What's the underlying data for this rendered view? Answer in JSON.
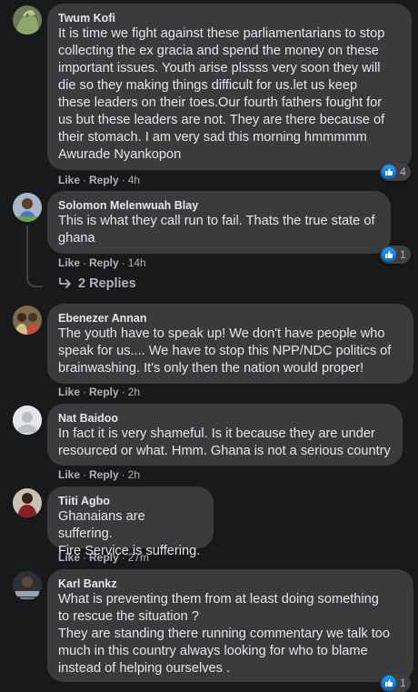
{
  "comments": [
    {
      "author": "Twum Kofi",
      "text": "It is time we fight against these parliamentarians to stop\ncollecting the ex gracia and spend the money on these\nimportant issues. Youth arise plssss very soon they will\ndie so they making things difficult for us.let us keep\nthese leaders on their toes.Our fourth fathers fought for\nus but these leaders are not. They are there because of\ntheir stomach. I am very sad this morning hmmmmm\nAwurade Nyankopon",
      "like": "Like",
      "reply": "Reply",
      "time": "4h",
      "reaction_count": "4"
    },
    {
      "author": "Solomon Melenwuah Blay",
      "text": "This is what they call run to fail. Thats the true state of\nghana",
      "like": "Like",
      "reply": "Reply",
      "time": "14h",
      "reaction_count": "1",
      "replies_label": "2 Replies"
    },
    {
      "author": "Ebenezer Annan",
      "text": "The youth have to speak up! We don't have people who\nspeak for us.... We have to stop this NPP/NDC politics of\nbrainwashing. It's only then the nation would proper!",
      "like": "Like",
      "reply": "Reply",
      "time": "2h"
    },
    {
      "author": "Nat Baidoo",
      "text": "In fact it is very shameful. Is it because they are under\nresourced or what. Hmm. Ghana is not a serious country",
      "like": "Like",
      "reply": "Reply",
      "time": "2h"
    },
    {
      "author": "Tiiti Agbo",
      "text": "Ghanaians are suffering.\nFire Service is suffering.",
      "like": "Like",
      "reply": "Reply",
      "time": "27m"
    },
    {
      "author": "Karl Bankz",
      "text": "What is preventing them from at least doing something\nto rescue the situation ?\nThey are standing there running commentary we talk too\nmuch in this country always looking for who to blame\ninstead of helping ourselves .",
      "reaction_count": "1"
    }
  ],
  "colors": {
    "background": "#18191a",
    "bubble": "#3a3b3c",
    "text": "#e4e6eb",
    "secondary_text": "#b0b3b8",
    "like_blue": "#1877f2"
  },
  "icons": {
    "reaction": "like-thumb-icon",
    "reply_arrow": "reply-arrow-icon",
    "avatar_default": "default-avatar-icon"
  }
}
